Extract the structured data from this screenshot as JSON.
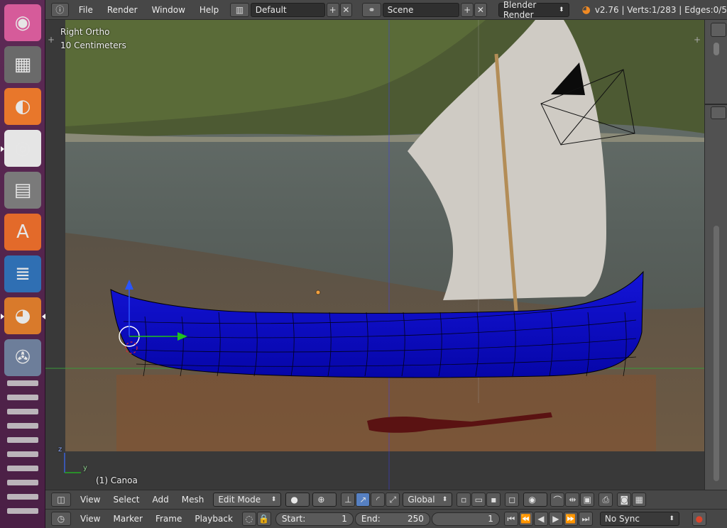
{
  "launcher": {
    "items": [
      {
        "name": "ubuntu-dash-icon",
        "glyph": "◉",
        "bg": "#d65b9a"
      },
      {
        "name": "calculator-icon",
        "glyph": "▦",
        "bg": "#6a6a6a"
      },
      {
        "name": "firefox-icon",
        "glyph": "◐",
        "bg": "#e8772b"
      },
      {
        "name": "chrome-icon",
        "glyph": "◎",
        "bg": "#e5e5e5"
      },
      {
        "name": "file-manager-icon",
        "glyph": "▤",
        "bg": "#7a7a7a"
      },
      {
        "name": "software-center-icon",
        "glyph": "A",
        "bg": "#e36a2a"
      },
      {
        "name": "writer-document-icon",
        "glyph": "≣",
        "bg": "#2f6fb3"
      },
      {
        "name": "blender-icon",
        "glyph": "◕",
        "bg": "#d97a2b"
      },
      {
        "name": "video-editor-icon",
        "glyph": "✇",
        "bg": "#6d7e9a"
      }
    ]
  },
  "topbar": {
    "menus": [
      "File",
      "Render",
      "Window",
      "Help"
    ],
    "screen_layout": "Default",
    "scene": "Scene",
    "engine": "Blender Render",
    "stats": "v2.76 | Verts:1/283 | Edges:0/5"
  },
  "viewport": {
    "view_name": "Right Ortho",
    "scale": "10 Centimeters",
    "object_label": "(1) Canoa",
    "axis_y": "y",
    "axis_z": "z"
  },
  "view3d_header": {
    "menus": [
      "View",
      "Select",
      "Add",
      "Mesh"
    ],
    "mode": "Edit Mode",
    "orientation": "Global"
  },
  "timeline_header": {
    "menus": [
      "View",
      "Marker",
      "Frame",
      "Playback"
    ],
    "start_label": "Start:",
    "start_value": "1",
    "end_label": "End:",
    "end_value": "250",
    "current_frame": "1",
    "sync": "No Sync"
  },
  "colors": {
    "mesh": "#0b0bc8",
    "accent": "#5680c2",
    "header": "#474747"
  }
}
